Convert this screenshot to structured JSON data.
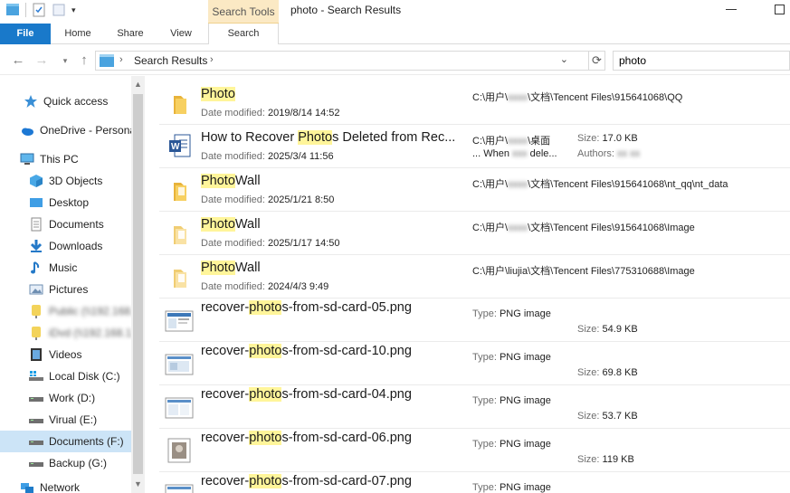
{
  "window": {
    "title": "photo - Search Results",
    "context_tab": "Search Tools"
  },
  "ribbon": {
    "tabs": [
      "File",
      "Home",
      "Share",
      "View",
      "Search"
    ]
  },
  "address": {
    "breadcrumb": "Search Results",
    "search_value": "photo"
  },
  "nav": {
    "items": [
      {
        "label": "Quick access",
        "icon": "star-icon"
      },
      {
        "label": "OneDrive - Personal",
        "icon": "cloud-icon"
      },
      {
        "label": "This PC",
        "icon": "pc-icon"
      },
      {
        "label": "3D Objects",
        "icon": "cube-icon"
      },
      {
        "label": "Desktop",
        "icon": "desktop-icon"
      },
      {
        "label": "Documents",
        "icon": "document-icon"
      },
      {
        "label": "Downloads",
        "icon": "download-icon"
      },
      {
        "label": "Music",
        "icon": "music-icon"
      },
      {
        "label": "Pictures",
        "icon": "pictures-icon"
      },
      {
        "label": "Public (\\\\192.168.1.1)",
        "icon": "network-drive-icon"
      },
      {
        "label": "iDvd (\\\\192.168.1.11)",
        "icon": "network-drive-icon"
      },
      {
        "label": "Videos",
        "icon": "video-icon"
      },
      {
        "label": "Local Disk (C:)",
        "icon": "windows-drive-icon"
      },
      {
        "label": "Work (D:)",
        "icon": "drive-icon"
      },
      {
        "label": "Virual (E:)",
        "icon": "drive-icon"
      },
      {
        "label": "Documents (F:)",
        "icon": "drive-icon"
      },
      {
        "label": "Backup (G:)",
        "icon": "drive-icon"
      },
      {
        "label": "Network",
        "icon": "network-icon"
      }
    ]
  },
  "results": [
    {
      "kind": "folder",
      "pre": "",
      "hl": "Photo",
      "post": "",
      "date_label": "Date modified:",
      "date": "2019/8/14 14:52",
      "path_pre": "C:\\用户\\",
      "path_post": "\\文档\\Tencent Files\\915641068\\QQ"
    },
    {
      "kind": "word",
      "pre": "How to Recover ",
      "hl": "Photo",
      "post": "s Deleted from Rec...",
      "date_label": "Date modified:",
      "date": "2025/3/4 11:56",
      "path_pre": "C:\\用户\\",
      "path_post": "\\桌面",
      "path2_pre": "... When ",
      "path2_post": " dele...",
      "size_label": "Size:",
      "size": "17.0 KB",
      "authors_label": "Authors:"
    },
    {
      "kind": "folder",
      "pre": "",
      "hl": "Photo",
      "post": "Wall",
      "date_label": "Date modified:",
      "date": "2025/1/21 8:50",
      "path_pre": "C:\\用户\\",
      "path_post": "\\文档\\Tencent Files\\915641068\\nt_qq\\nt_data"
    },
    {
      "kind": "folder-light",
      "pre": "",
      "hl": "Photo",
      "post": "Wall",
      "date_label": "Date modified:",
      "date": "2025/1/17 14:50",
      "path_pre": "C:\\用户\\",
      "path_post": "\\文档\\Tencent Files\\915641068\\Image"
    },
    {
      "kind": "folder-light",
      "pre": "",
      "hl": "Photo",
      "post": "Wall",
      "date_label": "Date modified:",
      "date": "2024/4/3 9:49",
      "path_pre": "C:\\用户\\liujia\\文档\\Tencent Files\\775310688\\Image",
      "path_post": ""
    },
    {
      "kind": "png",
      "pre": "recover-",
      "hl": "photo",
      "post": "s-from-sd-card-05.png",
      "type_label": "Type:",
      "type": "PNG image",
      "size_label": "Size:",
      "size": "54.9 KB"
    },
    {
      "kind": "png",
      "pre": "recover-",
      "hl": "photo",
      "post": "s-from-sd-card-10.png",
      "type_label": "Type:",
      "type": "PNG image",
      "size_label": "Size:",
      "size": "69.8 KB"
    },
    {
      "kind": "png",
      "pre": "recover-",
      "hl": "photo",
      "post": "s-from-sd-card-04.png",
      "type_label": "Type:",
      "type": "PNG image",
      "size_label": "Size:",
      "size": "53.7 KB"
    },
    {
      "kind": "png-photo",
      "pre": "recover-",
      "hl": "photo",
      "post": "s-from-sd-card-06.png",
      "type_label": "Type:",
      "type": "PNG image",
      "size_label": "Size:",
      "size": "119 KB"
    },
    {
      "kind": "png",
      "pre": "recover-",
      "hl": "photo",
      "post": "s-from-sd-card-07.png",
      "type_label": "Type:",
      "type": "PNG image",
      "size_label": "Size:",
      "size": ""
    }
  ],
  "colors": {
    "file_tab": "#1979ca",
    "context_tab": "#fbe9c4",
    "highlight": "#fff59a",
    "selection": "#cce4f7",
    "folder": "#f5c94b"
  }
}
